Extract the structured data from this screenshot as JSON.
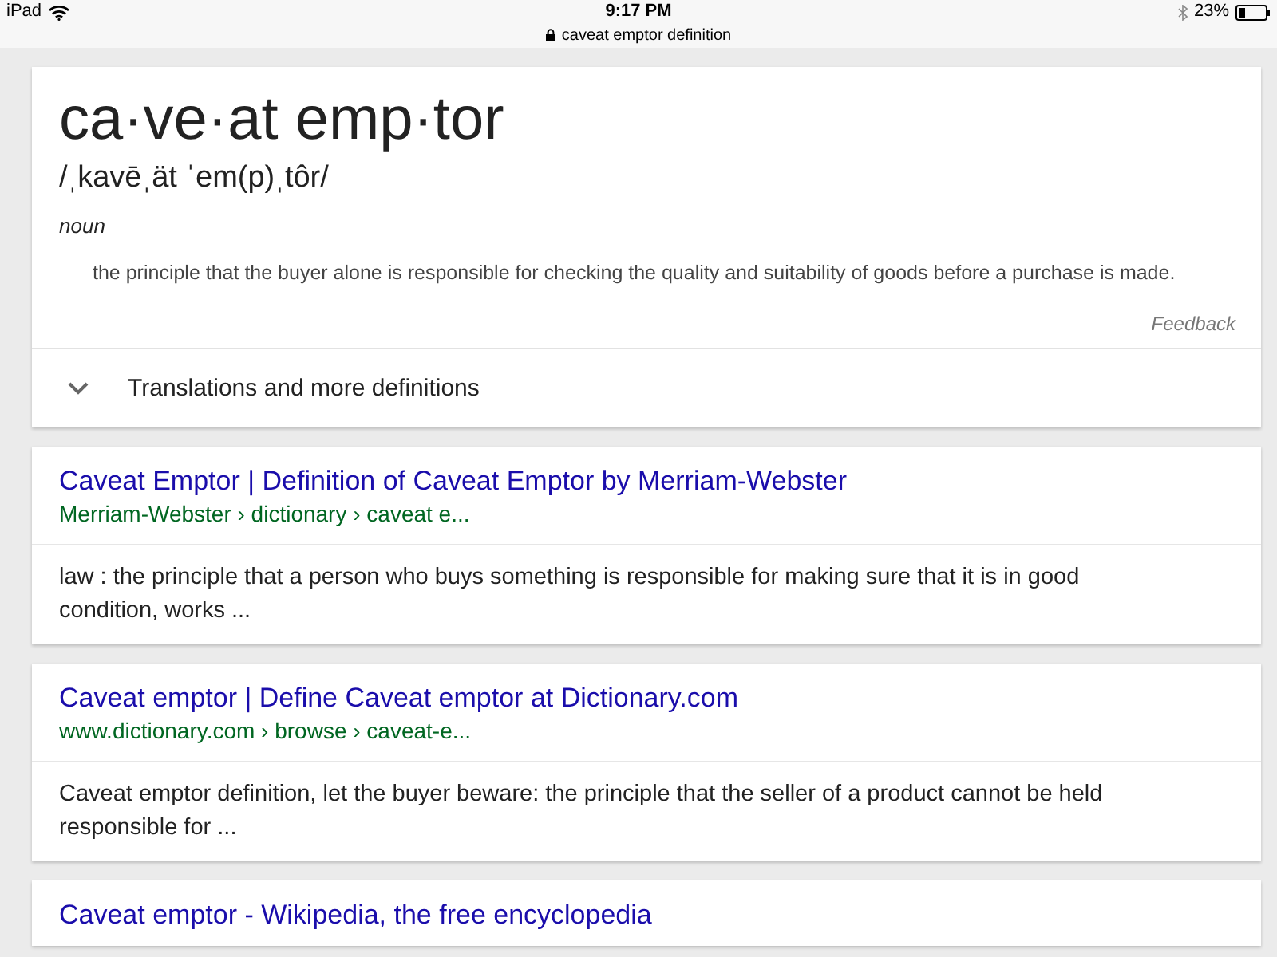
{
  "status_bar": {
    "device": "iPad",
    "time": "9:17 PM",
    "url": "caveat emptor definition",
    "battery": "23%"
  },
  "dictionary": {
    "headword": "ca·ve·at emp·tor",
    "pronunciation": "/ˌkavēˌät ˈem(p)ˌtôr/",
    "part_of_speech": "noun",
    "definition": "the principle that the buyer alone is responsible for checking the quality and suitability of goods before a purchase is made.",
    "feedback": "Feedback",
    "more": {
      "label": "Translations and more definitions"
    }
  },
  "results": [
    {
      "title": "Caveat Emptor | Definition of Caveat Emptor by Merriam-Webster",
      "url": "Merriam-Webster › dictionary › caveat e...",
      "snippet": "law : the principle that a person who buys something is responsible for making sure that it is in good condition, works ..."
    },
    {
      "title": "Caveat emptor | Define Caveat emptor at Dictionary.com",
      "url": "www.dictionary.com › browse › caveat-e...",
      "snippet": "Caveat emptor definition, let the buyer beware: the principle that the seller of a product cannot be held responsible for ..."
    },
    {
      "title": "Caveat emptor - Wikipedia, the free encyclopedia"
    }
  ]
}
